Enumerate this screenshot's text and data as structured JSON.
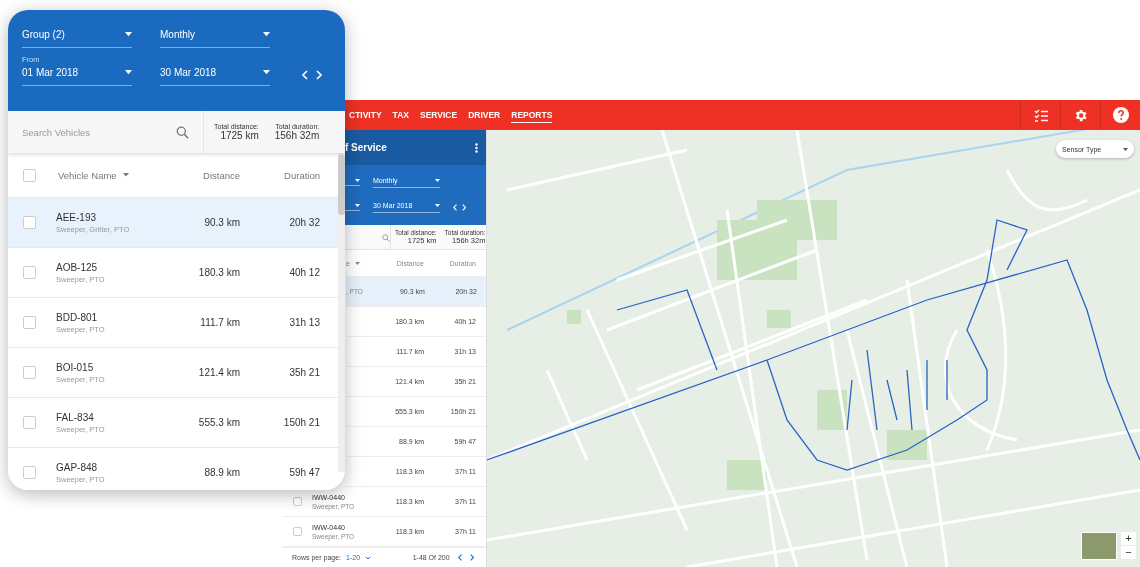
{
  "app": {
    "nav_tabs": [
      {
        "label": "CTIVITY",
        "selected": false
      },
      {
        "label": "TAX",
        "selected": false
      },
      {
        "label": "SERVICE",
        "selected": false
      },
      {
        "label": "DRIVER",
        "selected": false
      },
      {
        "label": "REPORTS",
        "selected": true
      }
    ],
    "panel": {
      "title": "f Service",
      "period": "Monthly",
      "end_date": "30 Mar 2018",
      "total_distance_label": "Total distance:",
      "total_distance": "1725 km",
      "total_duration_label": "Total duration:",
      "total_duration": "156h 32m",
      "columns": [
        "e",
        "Distance",
        "Duration"
      ],
      "rows": [
        {
          "sub": ", PTO",
          "distance": "90.3 km",
          "duration": "20h 32",
          "selected": true
        },
        {
          "distance": "180.3 km",
          "duration": "40h 12",
          "selected": false
        },
        {
          "distance": "111.7 km",
          "duration": "31h 13",
          "selected": false
        },
        {
          "distance": "121.4 km",
          "duration": "35h 21",
          "selected": false
        },
        {
          "distance": "555.3 km",
          "duration": "150h  21",
          "selected": false
        },
        {
          "distance": "88.9 km",
          "duration": "59h 47",
          "selected": false
        },
        {
          "distance": "118.3 km",
          "duration": "37h 11",
          "selected": false
        },
        {
          "name": "IWW-0440",
          "sub": "Sweeper, PTO",
          "distance": "118.3 km",
          "duration": "37h 11",
          "selected": false,
          "checked": false
        },
        {
          "name": "IWW-0440",
          "sub": "Sweeper, PTO",
          "distance": "118.3 km",
          "duration": "37h 11",
          "selected": false,
          "checked": false
        }
      ],
      "rows_per_page_label": "Rows per page:",
      "rows_per_page": "1-20",
      "range": "1-48 Of 200"
    },
    "map": {
      "sensor_select": "Sensor Type",
      "zoom_in": "+",
      "zoom_out": "−"
    }
  },
  "card": {
    "select_all_checked": false,
    "group": "Group (2)",
    "period": "Monthly",
    "from_label": "From",
    "start_date": "01 Mar 2018",
    "end_date": "30 Mar 2018",
    "search_placeholder": "Search Vehicles",
    "total_distance_label": "Total distance:",
    "total_distance": "1725 km",
    "total_duration_label": "Total duration:",
    "total_duration": "156h 32m",
    "columns": [
      "Vehicle Name",
      "Distance",
      "Duration"
    ],
    "rows": [
      {
        "name": "AEE-193",
        "sub": "Sweeper, Gritter, PTO",
        "distance": "90.3 km",
        "duration": "20h 32",
        "selected": true,
        "checked": false
      },
      {
        "name": "AOB-125",
        "sub": "Sweeper, PTO",
        "distance": "180.3 km",
        "duration": "40h 12",
        "selected": false,
        "checked": false
      },
      {
        "name": "BDD-801",
        "sub": "Sweeper, PTO",
        "distance": "111.7 km",
        "duration": "31h 13",
        "selected": false,
        "checked": false
      },
      {
        "name": "BOI-015",
        "sub": "Sweeper, PTO",
        "distance": "121.4 km",
        "duration": "35h 21",
        "selected": false,
        "checked": false
      },
      {
        "name": "FAL-834",
        "sub": "Sweeper, PTO",
        "distance": "555.3 km",
        "duration": "150h  21",
        "selected": false,
        "checked": false
      },
      {
        "name": "GAP-848",
        "sub": "Sweeper, PTO",
        "distance": "88.9 km",
        "duration": "59h 47",
        "selected": false,
        "checked": false
      }
    ]
  }
}
